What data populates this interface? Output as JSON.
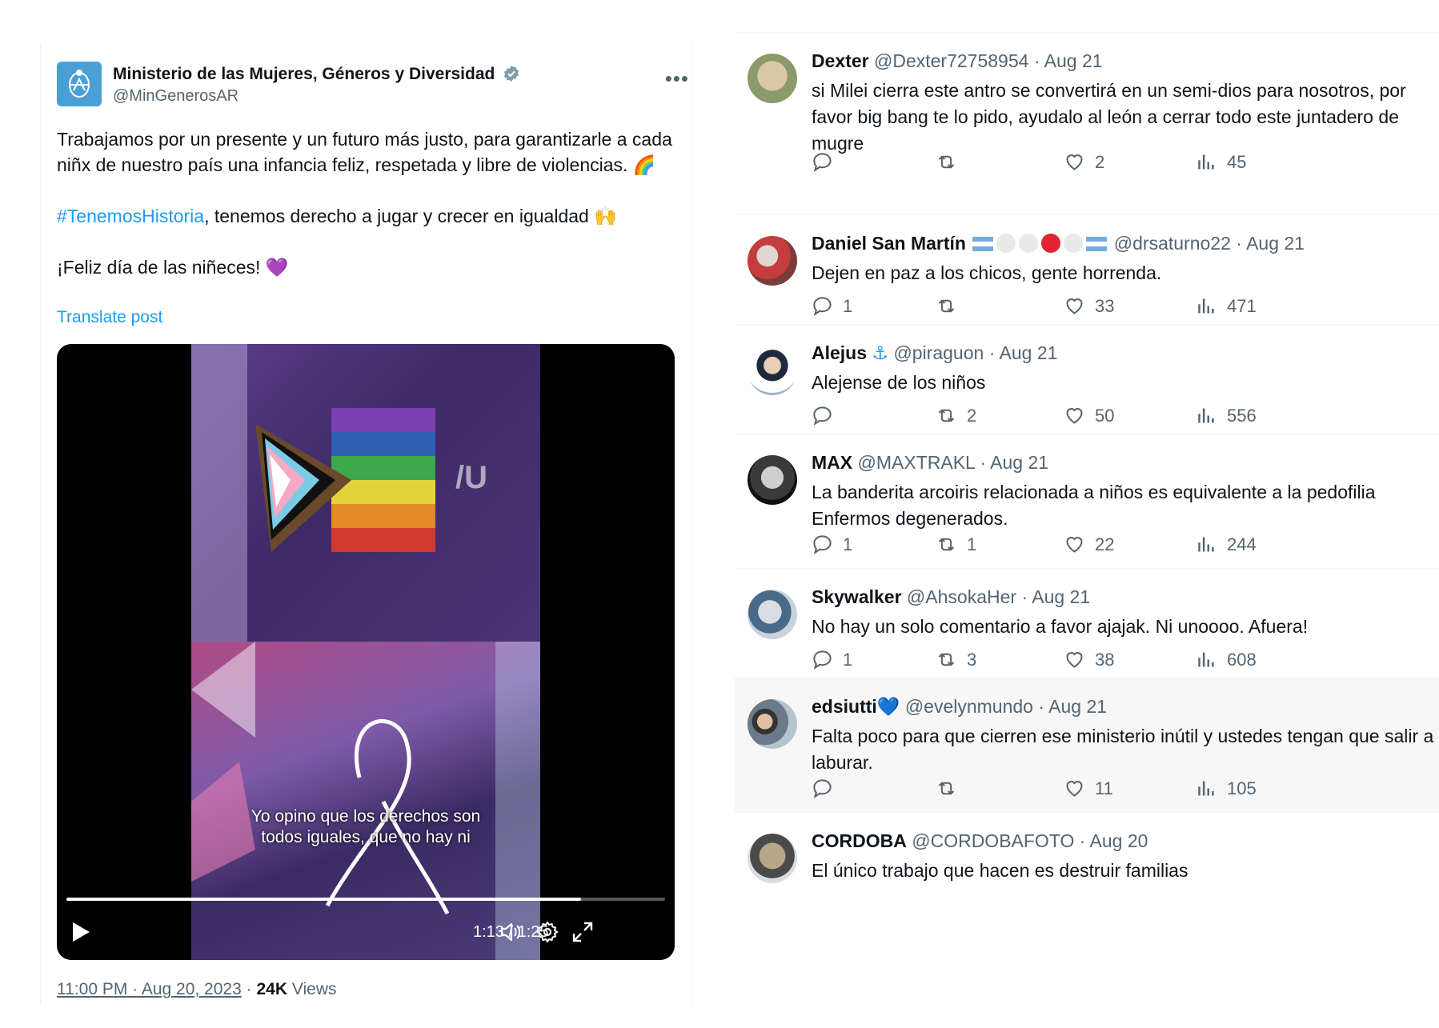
{
  "post": {
    "org_name": "Ministerio de las Mujeres, Géneros y Diversidad",
    "handle": "@MinGenerosAR",
    "text_line1": "Trabajamos por un presente y un futuro más justo, para garantizarle a cada niñx de nuestro país una infancia feliz, respetada y libre de violencias.",
    "emoji_rainbow": "🌈",
    "hashtag": "#TenemosHistoria",
    "text_line2": ", tenemos derecho a jugar y crecer en igualdad",
    "emoji_hands": "🙌",
    "text_line3": "¡Feliz día de las niñeces!",
    "emoji_heart": "💜",
    "translate": "Translate post",
    "video": {
      "subtitle_1": "Yo opino que los derechos son",
      "subtitle_2": "todos iguales, que no hay ni",
      "time": "1:13 / 1:25",
      "progress": 0.86
    },
    "timestamp": "11:00 PM · Aug 20, 2023",
    "views_count": "24K",
    "views_label": "Views",
    "colors": {
      "accent": "#1d9bf0",
      "muted": "#536471",
      "verified": "#829aab"
    }
  },
  "replies": [
    {
      "name": "Dexter",
      "handle": "@Dexter72758954",
      "date": "Aug 21",
      "text": "si Milei cierra este antro se convertirá en un semi-dios para nosotros, por favor big bang te lo pido, ayudalo al león a cerrar todo este juntadero de mugre",
      "replies": "",
      "reposts": "",
      "likes": "2",
      "views": "45"
    },
    {
      "name": "Daniel San Martín",
      "handle": "@drsaturno22",
      "date": "Aug 21",
      "text": "Dejen en paz a los chicos, gente horrenda.",
      "replies": "1",
      "reposts": "",
      "likes": "33",
      "views": "471"
    },
    {
      "name": "Alejus",
      "name_emoji": "⚓",
      "handle": "@piraguon",
      "date": "Aug 21",
      "text": "Alejense de los niños",
      "replies": "",
      "reposts": "2",
      "likes": "50",
      "views": "556"
    },
    {
      "name": "MAX",
      "handle": "@MAXTRAKL",
      "date": "Aug 21",
      "text": "La banderita arcoiris relacionada a niños es equivalente a la pedofilia Enfermos degenerados.",
      "replies": "1",
      "reposts": "1",
      "likes": "22",
      "views": "244"
    },
    {
      "name": "Skywalker",
      "handle": "@AhsokaHer",
      "date": "Aug 21",
      "text": "No hay un solo comentario a favor ajajak. Ni unoooo. Afuera!",
      "replies": "1",
      "reposts": "3",
      "likes": "38",
      "views": "608"
    },
    {
      "name": "edsiutti",
      "name_emoji": "💙",
      "handle": "@evelynmundo",
      "date": "Aug 21",
      "text": "Falta poco para que cierren ese ministerio inútil y ustedes tengan que salir a laburar.",
      "replies": "",
      "reposts": "",
      "likes": "11",
      "views": "105"
    },
    {
      "name": "CORDOBA",
      "handle": "@CORDOBAFOTO",
      "date": "Aug 20",
      "text": "El único trabajo que hacen es destruir familias",
      "replies": "",
      "reposts": "",
      "likes": "",
      "views": ""
    }
  ]
}
